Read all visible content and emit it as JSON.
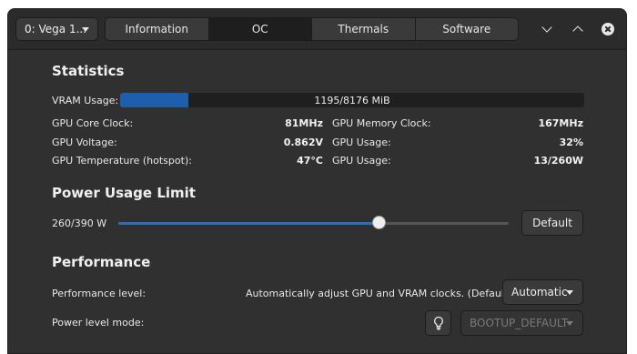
{
  "header": {
    "gpu_select": "0: Vega 1...",
    "tabs": [
      "Information",
      "OC",
      "Thermals",
      "Software"
    ],
    "active_tab": "OC"
  },
  "statistics": {
    "title": "Statistics",
    "vram_label": "VRAM Usage:",
    "vram_text": "1195/8176 MiB",
    "vram_used": 1195,
    "vram_total": 8176,
    "rows": [
      {
        "left_label": "GPU Core Clock:",
        "left_value": "81MHz",
        "right_label": "GPU Memory Clock:",
        "right_value": "167MHz"
      },
      {
        "left_label": "GPU Voltage:",
        "left_value": "0.862V",
        "right_label": "GPU Usage:",
        "right_value": "32%"
      },
      {
        "left_label": "GPU Temperature (hotspot):",
        "left_value": "47°C",
        "right_label": "GPU Usage:",
        "right_value": "13/260W"
      }
    ]
  },
  "power": {
    "title": "Power Usage Limit",
    "value_label": "260/390 W",
    "current": 260,
    "max": 390,
    "default_button": "Default"
  },
  "performance": {
    "title": "Performance",
    "level_label": "Performance level:",
    "level_description": "Automatically adjust GPU and VRAM clocks. (Default)",
    "level_value": "Automatic",
    "mode_label": "Power level mode:",
    "mode_value": "BOOTUP_DEFAULT"
  },
  "icons": {
    "minimize": "chevron-down-icon",
    "maximize": "chevron-up-icon",
    "close": "close-icon",
    "bulb": "lightbulb-icon"
  },
  "colors": {
    "accent": "#1d5fad",
    "window_bg": "#303030",
    "header_bg": "#2b2b2b"
  }
}
